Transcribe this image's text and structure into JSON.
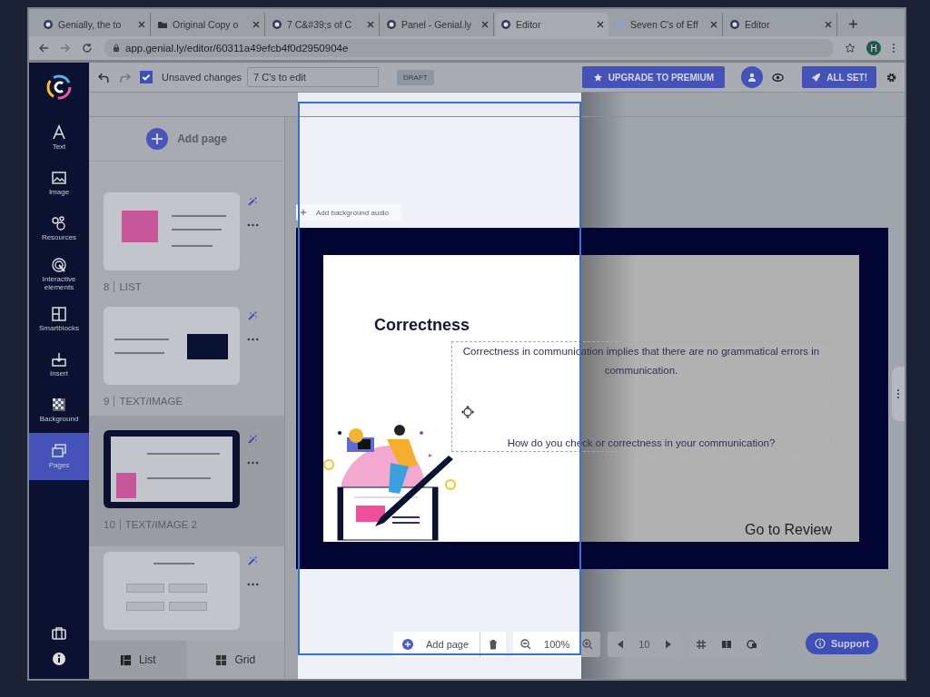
{
  "browser": {
    "tabs": [
      {
        "title": "Genially, the to",
        "kind": "logo",
        "selected": false
      },
      {
        "title": "Original Copy o",
        "kind": "folder",
        "selected": false
      },
      {
        "title": "7 C&#39;s of C",
        "kind": "logo",
        "selected": false
      },
      {
        "title": "Panel - Genial.ly",
        "kind": "logo",
        "selected": false
      },
      {
        "title": "Editor",
        "kind": "logo",
        "selected": true
      },
      {
        "title": "Seven C's of Eff",
        "kind": "doc",
        "selected": false
      },
      {
        "title": "Editor",
        "kind": "logo",
        "selected": false
      }
    ],
    "url": "app.genial.ly/editor/60311a49efcb4f0d2950904e",
    "profile_initial": "H"
  },
  "nav": {
    "items": [
      {
        "label": "Text",
        "kind": "text",
        "selected": false
      },
      {
        "label": "Image",
        "kind": "image",
        "selected": false
      },
      {
        "label": "Resources",
        "kind": "resources",
        "selected": false
      },
      {
        "label": "Interactive elements",
        "kind": "interactive",
        "selected": false
      },
      {
        "label": "Smartblocks",
        "kind": "smartblocks",
        "selected": false
      },
      {
        "label": "Insert",
        "kind": "insert",
        "selected": false
      },
      {
        "label": "Background",
        "kind": "background",
        "selected": false
      },
      {
        "label": "Pages",
        "kind": "pages",
        "selected": true
      }
    ]
  },
  "toolbar": {
    "autosave_checked": true,
    "status": "Unsaved changes",
    "title_value": "7 C's to edit",
    "draft_label": "DRAFT",
    "upgrade_label": "UPGRADE TO PREMIUM",
    "publish_label": "ALL SET!"
  },
  "pages_panel": {
    "add_label": "Add page",
    "pages": [
      {
        "number": "8",
        "name": "LIST",
        "kind": "list",
        "selected": false
      },
      {
        "number": "9",
        "name": "TEXT/IMAGE",
        "kind": "text-image",
        "selected": false
      },
      {
        "number": "10",
        "name": "TEXT/IMAGE 2",
        "kind": "text-image-2",
        "selected": true
      },
      {
        "kind": "form",
        "selected": false
      }
    ],
    "view_tabs": [
      {
        "label": "List",
        "kind": "list",
        "selected": true
      },
      {
        "label": "Grid",
        "kind": "grid",
        "selected": false
      }
    ]
  },
  "canvas": {
    "audio_label": "Add background audio",
    "slide": {
      "title": "Correctness",
      "body": "Correctness in communication implies that there are no grammatical errors in communication.",
      "question": "How do you check or correctness in your communication?",
      "link": "Go to Review"
    }
  },
  "bottom_bar": {
    "add_label": "Add page",
    "zoom": "100%",
    "page": "10"
  },
  "support_label": "Support"
}
